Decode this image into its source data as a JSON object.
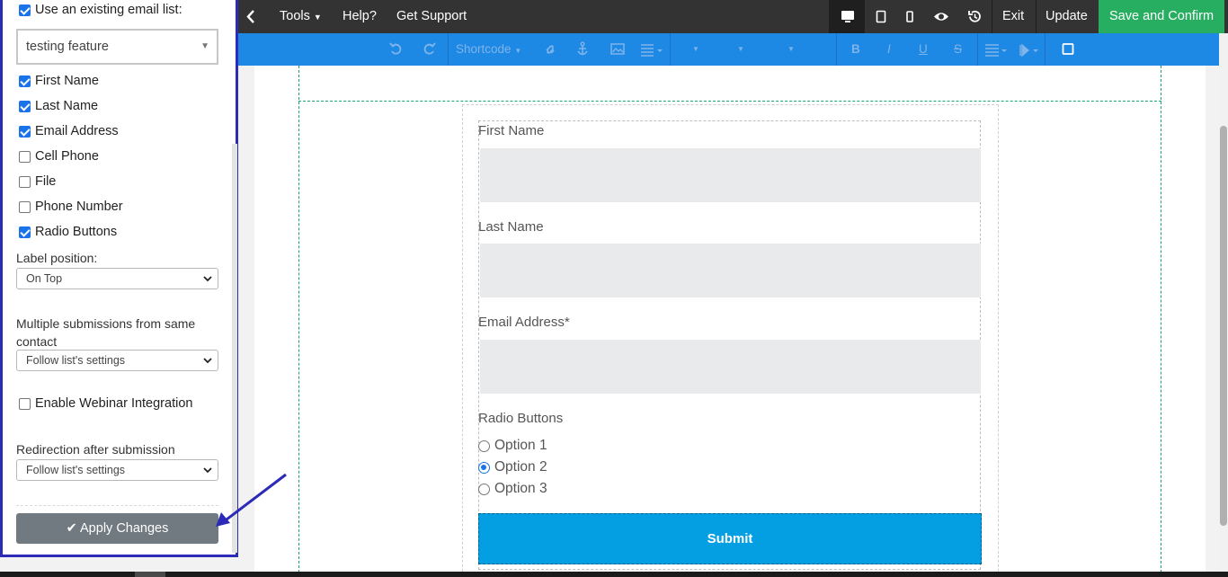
{
  "topbar": {
    "tools": "Tools",
    "help": "Help?",
    "support": "Get Support",
    "exit": "Exit",
    "update": "Update",
    "save": "Save and Confirm"
  },
  "toolbar": {
    "shortcode": "Shortcode"
  },
  "panel": {
    "use_list_label": "Use an existing email list:",
    "list_value": "testing feature",
    "fields": [
      {
        "label": "First Name",
        "checked": true
      },
      {
        "label": "Last Name",
        "checked": true
      },
      {
        "label": "Email Address",
        "checked": true
      },
      {
        "label": "Cell Phone",
        "checked": false
      },
      {
        "label": "File",
        "checked": false
      },
      {
        "label": "Phone Number",
        "checked": false
      },
      {
        "label": "Radio Buttons",
        "checked": true
      }
    ],
    "label_position_title": "Label position:",
    "label_position_value": "On Top",
    "multiple_title": "Multiple submissions from same contact",
    "multiple_value": "Follow list's settings",
    "webinar_label": "Enable Webinar Integration",
    "redirect_title": "Redirection after submission",
    "redirect_value": "Follow list's settings",
    "apply_label": "Apply Changes"
  },
  "form": {
    "first_name_label": "First Name",
    "last_name_label": "Last Name",
    "email_label": "Email Address*",
    "radio_label": "Radio Buttons",
    "options": [
      "Option 1",
      "Option 2",
      "Option 3"
    ],
    "selected_option": 1,
    "submit_label": "Submit"
  },
  "colors": {
    "topbar": "#333333",
    "toolbar": "#1e88e5",
    "save": "#27ae60",
    "submit": "#049fe2",
    "panel_border": "#2b2bb8"
  }
}
